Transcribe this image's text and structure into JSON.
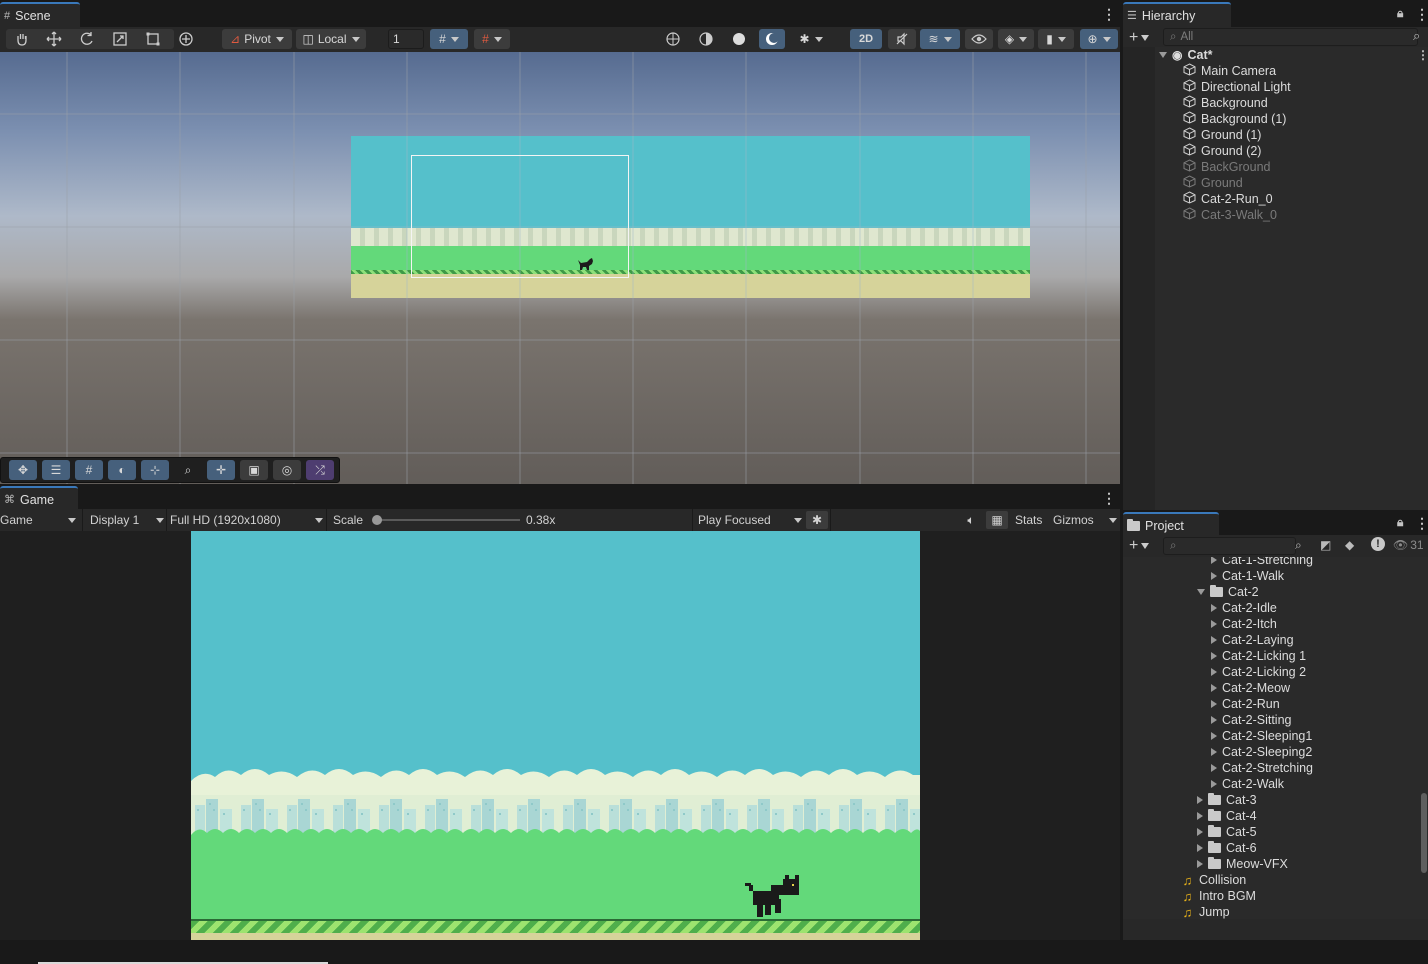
{
  "scene": {
    "tab_label": "Scene",
    "pivot_label": "Pivot",
    "local_label": "Local",
    "grid_value": "1",
    "mode_2d": "2D"
  },
  "game": {
    "tab_label": "Game",
    "game_select": "Game",
    "display_select": "Display 1",
    "resolution_select": "Full HD (1920x1080)",
    "scale_label": "Scale",
    "scale_value": "0.38x",
    "scale_fraction": 0.02,
    "play_focused": "Play Focused",
    "stats_label": "Stats",
    "gizmos_label": "Gizmos"
  },
  "hierarchy": {
    "tab_label": "Hierarchy",
    "search_placeholder": "All",
    "scene_name": "Cat*",
    "items": [
      {
        "label": "Main Camera",
        "active": true
      },
      {
        "label": "Directional Light",
        "active": true
      },
      {
        "label": "Background",
        "active": true
      },
      {
        "label": "Background (1)",
        "active": true
      },
      {
        "label": "Ground (1)",
        "active": true
      },
      {
        "label": "Ground (2)",
        "active": true
      },
      {
        "label": "BackGround",
        "active": false
      },
      {
        "label": "Ground",
        "active": false
      },
      {
        "label": "Cat-2-Run_0",
        "active": true
      },
      {
        "label": "Cat-3-Walk_0",
        "active": false
      }
    ]
  },
  "project": {
    "tab_label": "Project",
    "visible_count": "31",
    "items": [
      {
        "label": "Cat-1-Stretching",
        "kind": "anim",
        "indent": 2
      },
      {
        "label": "Cat-1-Walk",
        "kind": "anim",
        "indent": 2
      },
      {
        "label": "Cat-2",
        "kind": "folder-open",
        "indent": 1
      },
      {
        "label": "Cat-2-Idle",
        "kind": "anim",
        "indent": 2
      },
      {
        "label": "Cat-2-Itch",
        "kind": "anim",
        "indent": 2
      },
      {
        "label": "Cat-2-Laying",
        "kind": "anim",
        "indent": 2
      },
      {
        "label": "Cat-2-Licking 1",
        "kind": "anim",
        "indent": 2
      },
      {
        "label": "Cat-2-Licking 2",
        "kind": "anim",
        "indent": 2
      },
      {
        "label": "Cat-2-Meow",
        "kind": "anim",
        "indent": 2
      },
      {
        "label": "Cat-2-Run",
        "kind": "anim",
        "indent": 2
      },
      {
        "label": "Cat-2-Sitting",
        "kind": "anim",
        "indent": 2
      },
      {
        "label": "Cat-2-Sleeping1",
        "kind": "anim",
        "indent": 2
      },
      {
        "label": "Cat-2-Sleeping2",
        "kind": "anim",
        "indent": 2
      },
      {
        "label": "Cat-2-Stretching",
        "kind": "anim",
        "indent": 2
      },
      {
        "label": "Cat-2-Walk",
        "kind": "anim",
        "indent": 2
      },
      {
        "label": "Cat-3",
        "kind": "folder",
        "indent": 1
      },
      {
        "label": "Cat-4",
        "kind": "folder",
        "indent": 1
      },
      {
        "label": "Cat-5",
        "kind": "folder",
        "indent": 1
      },
      {
        "label": "Cat-6",
        "kind": "folder",
        "indent": 1
      },
      {
        "label": "Meow-VFX",
        "kind": "folder",
        "indent": 1
      },
      {
        "label": "Collision",
        "kind": "audio",
        "indent": 0
      },
      {
        "label": "Intro BGM",
        "kind": "audio",
        "indent": 0
      },
      {
        "label": "Jump",
        "kind": "audio",
        "indent": 0
      }
    ]
  },
  "colors": {
    "sky": "#55c0cb",
    "grass": "#63d97a",
    "ground": "#d6d39a",
    "accent": "#3a79bb"
  }
}
